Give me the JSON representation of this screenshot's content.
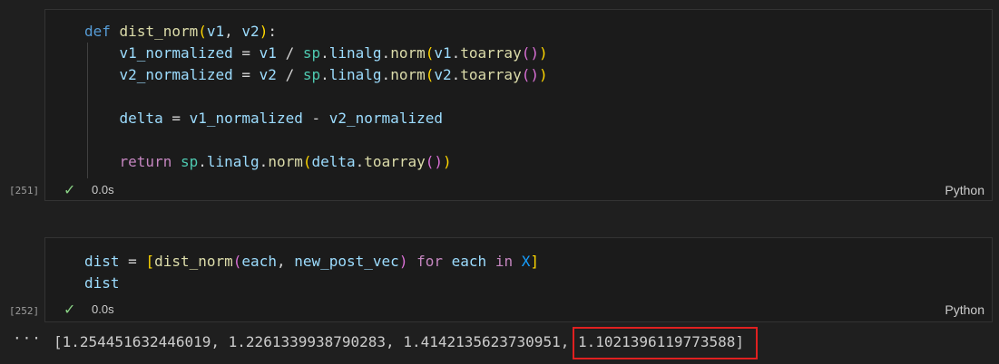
{
  "cells": [
    {
      "exec_count": "[251]",
      "code_lines": [
        "def dist_norm(v1, v2):",
        "    v1_normalized = v1 / sp.linalg.norm(v1.toarray())",
        "    v2_normalized = v2 / sp.linalg.norm(v2.toarray())",
        "",
        "    delta = v1_normalized - v2_normalized",
        "",
        "    return sp.linalg.norm(delta.toarray())"
      ],
      "status_icon": "check-icon",
      "exec_time": "0.0s",
      "language": "Python"
    },
    {
      "exec_count": "[252]",
      "code_lines": [
        "dist = [dist_norm(each, new_post_vec) for each in X]",
        "dist"
      ],
      "status_icon": "check-icon",
      "exec_time": "0.0s",
      "language": "Python",
      "output_menu_icon": "ellipsis-icon",
      "output_text": "[1.254451632446019, 1.2261339938790283, 1.4142135623730951, 1.1021396119773588]"
    }
  ],
  "colors": {
    "success": "#89d185",
    "highlight": "#e02020"
  }
}
